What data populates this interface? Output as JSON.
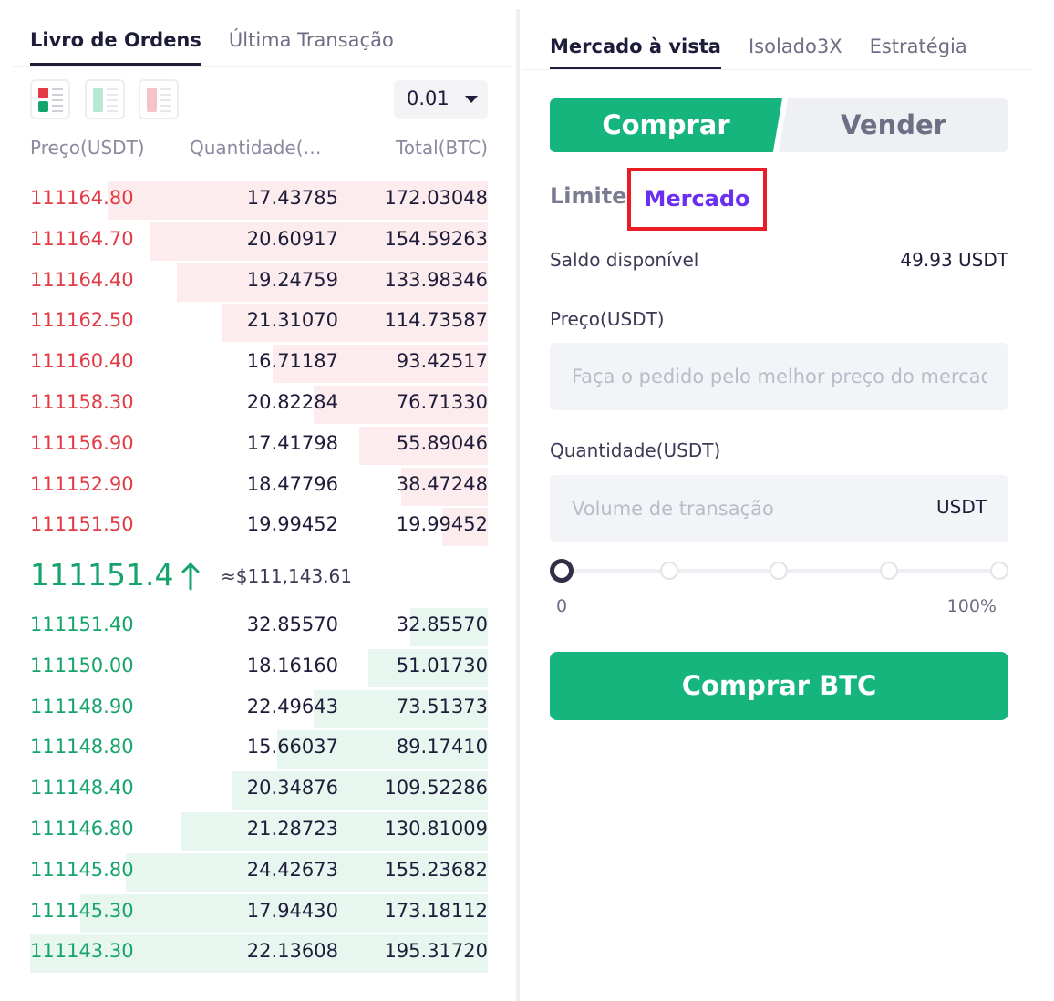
{
  "order_book": {
    "tabs": [
      {
        "label": "Livro de Ordens",
        "active": true
      },
      {
        "label": "Última Transação",
        "active": false
      }
    ],
    "precision": "0.01",
    "columns": {
      "price": "Preço(USDT)",
      "quantity": "Quantidade(…",
      "total": "Total(BTC)"
    },
    "asks": [
      {
        "price": "111164.80",
        "quantity": "17.43785",
        "total": "172.03048",
        "depth": 0.83
      },
      {
        "price": "111164.70",
        "quantity": "20.60917",
        "total": "154.59263",
        "depth": 0.74
      },
      {
        "price": "111164.40",
        "quantity": "19.24759",
        "total": "133.98346",
        "depth": 0.68
      },
      {
        "price": "111162.50",
        "quantity": "21.31070",
        "total": "114.73587",
        "depth": 0.58
      },
      {
        "price": "111160.40",
        "quantity": "16.71187",
        "total": "93.42517",
        "depth": 0.47
      },
      {
        "price": "111158.30",
        "quantity": "20.82284",
        "total": "76.71330",
        "depth": 0.38
      },
      {
        "price": "111156.90",
        "quantity": "17.41798",
        "total": "55.89046",
        "depth": 0.28
      },
      {
        "price": "111152.90",
        "quantity": "18.47796",
        "total": "38.47248",
        "depth": 0.19
      },
      {
        "price": "111151.50",
        "quantity": "19.99452",
        "total": "19.99452",
        "depth": 0.1
      }
    ],
    "last_price": "111151.4",
    "last_price_usd": "≈$111,143.61",
    "bids": [
      {
        "price": "111151.40",
        "quantity": "32.85570",
        "total": "32.85570",
        "depth": 0.17
      },
      {
        "price": "111150.00",
        "quantity": "18.16160",
        "total": "51.01730",
        "depth": 0.26
      },
      {
        "price": "111148.90",
        "quantity": "22.49643",
        "total": "73.51373",
        "depth": 0.38
      },
      {
        "price": "111148.80",
        "quantity": "15.66037",
        "total": "89.17410",
        "depth": 0.46
      },
      {
        "price": "111148.40",
        "quantity": "20.34876",
        "total": "109.52286",
        "depth": 0.56
      },
      {
        "price": "111146.80",
        "quantity": "21.28723",
        "total": "130.81009",
        "depth": 0.67
      },
      {
        "price": "111145.80",
        "quantity": "24.42673",
        "total": "155.23682",
        "depth": 0.79
      },
      {
        "price": "111145.30",
        "quantity": "17.94430",
        "total": "173.18112",
        "depth": 0.89
      },
      {
        "price": "111143.30",
        "quantity": "22.13608",
        "total": "195.31720",
        "depth": 1.0
      }
    ]
  },
  "trade": {
    "tabs": [
      {
        "label": "Mercado à vista",
        "active": true
      },
      {
        "label": "Isolado3X",
        "active": false
      },
      {
        "label": "Estratégia",
        "active": false
      }
    ],
    "buy_label": "Comprar",
    "sell_label": "Vender",
    "order_types": {
      "limit": "Limite",
      "market": "Mercado",
      "selected": "market"
    },
    "balance_label": "Saldo disponível",
    "balance_value": "49.93 USDT",
    "price_label": "Preço(USDT)",
    "price_placeholder": "Faça o pedido pelo melhor preço do mercado",
    "quantity_label": "Quantidade(USDT)",
    "quantity_placeholder": "Volume de transação",
    "quantity_unit": "USDT",
    "slider": {
      "min_label": "0",
      "max_label": "100%",
      "value_percent": 0
    },
    "submit_label": "Comprar BTC"
  },
  "colors": {
    "ask": "#e23b46",
    "bid": "#16a46c",
    "buy_button": "#16b57d",
    "market_highlight": "#6a2ff0",
    "highlight_box": "#ea1c24"
  }
}
